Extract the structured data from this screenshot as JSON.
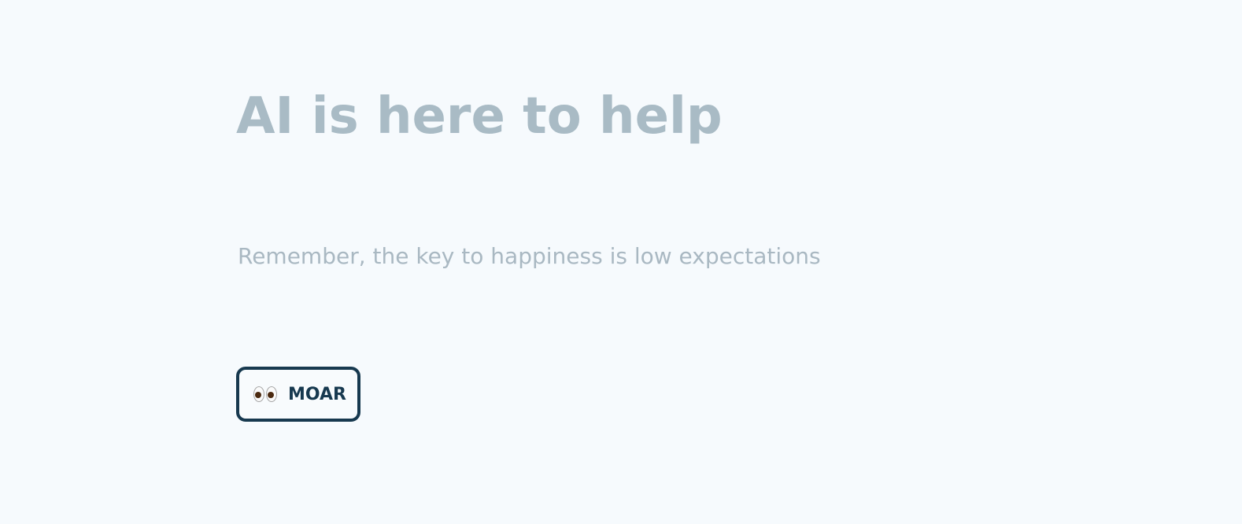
{
  "hero": {
    "title": "AI is here to help",
    "subtitle": "Remember, the key to happiness is low expectations"
  },
  "action": {
    "label": "MOAR",
    "icon": "eyes-icon"
  },
  "colors": {
    "background": "#f6fafd",
    "title_text": "#a9bbc5",
    "subtitle_text": "#a9b8c2",
    "button_border": "#17394f",
    "button_text": "#17394f"
  }
}
